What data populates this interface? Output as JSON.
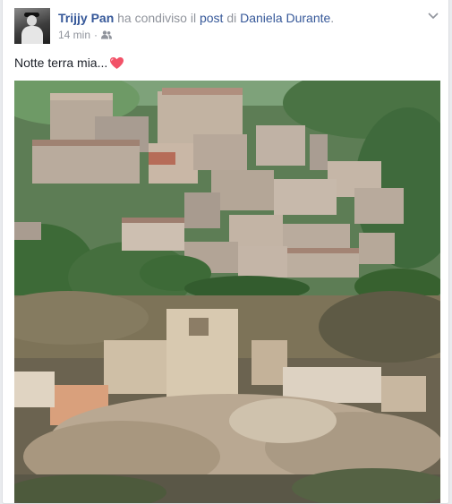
{
  "post": {
    "author": "Trijjy Pan",
    "action_text": "ha condiviso il",
    "post_link": "post",
    "of_text": "di",
    "original_author": "Daniela Durante",
    "end_punct": ".",
    "timestamp": "14 min",
    "separator": "·",
    "audience_icon": "friends-icon",
    "message": "Notte terra mia...",
    "emoji": "heart-icon"
  },
  "colors": {
    "link": "#365899",
    "muted": "#90949c",
    "heart": "#f25268"
  }
}
